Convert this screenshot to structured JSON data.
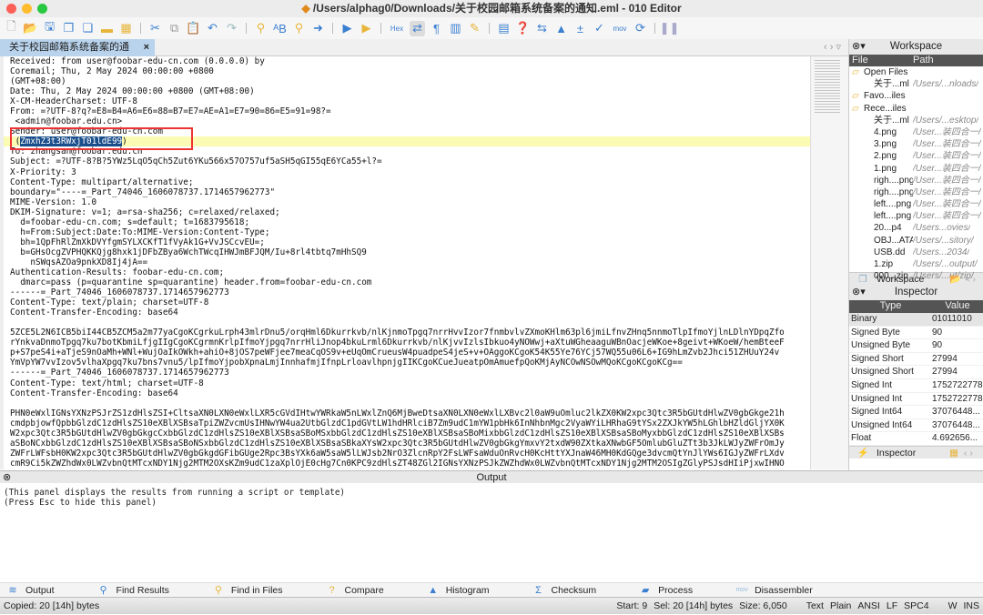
{
  "window": {
    "title": "/Users/alphag0/Downloads/关于校园邮箱系统备案的通知.eml - 010 Editor"
  },
  "toolbar": {
    "hex_label": "Hex",
    "mov_label": "mov",
    "icons": [
      "new-file-icon",
      "open-file-icon",
      "save-icon",
      "save-as-icon",
      "save-all-icon",
      "open-folder-icon",
      "workspace-icon",
      "cut-icon",
      "copy-icon",
      "paste-icon",
      "undo-icon",
      "redo-icon",
      "find-icon",
      "replace-icon",
      "find-in-files-icon",
      "goto-icon",
      "run-script-icon",
      "run-template-icon",
      "hex-mode-icon",
      "toggle-icon",
      "pilcrow-icon",
      "columns-icon",
      "highlight-icon",
      "calculator-icon",
      "clipboard-icon",
      "compare-icon",
      "histogram-icon",
      "checksum-icon",
      "edit-icon",
      "disassembler-icon",
      "base-convert-icon",
      "pause-icon"
    ]
  },
  "file_tab": {
    "label": "关于校园邮箱系统备案的通知.eml",
    "close": "×"
  },
  "editor": {
    "lines": [
      "Received: from user@foobar-edu-cn.com (0.0.0.0) by",
      "Coremail; Thu, 2 May 2024 00:00:00 +0800",
      "(GMT+08:00)",
      "Date: Thu, 2 May 2024 00:00:00 +0800 (GMT+08:00)",
      "X-CM-HeaderCharset: UTF-8",
      "From: =?UTF-8?q?=E8=B4=A6=E6=88=B7=E7=AE=A1=E7=90=86=E5=91=98?=",
      " <admin@foobar.edu.cn>",
      "Sender: user@foobar-edu-cn.com",
      "",
      "To: zhangsan@foobar.edu.cn",
      "Subject: =?UTF-8?B?5YWz5LqO5qCh5Zut6YKu566x57O757uf5aSH5qGI55qE6YCa55+l?=",
      "X-Priority: 3",
      "Content-Type: multipart/alternative;",
      "boundary=\"----=_Part_74046_1606078737.1714657962773\"",
      "MIME-Version: 1.0",
      "DKIM-Signature: v=1; a=rsa-sha256; c=relaxed/relaxed;",
      "  d=foobar-edu-cn.com; s=default; t=1683795618;",
      "  h=From:Subject:Date:To:MIME-Version:Content-Type;",
      "  bh=1QpFhRlZmXkDVYfgmSYLXCKfT1fVyAk1G+VvJSCcvEU=;",
      "  b=GHsOcgZVPHQKKQjg8hxk1jDFbZBya6WchTWcqIHWJmBFJQM/Iu+8rl4tbtq7mHhSQ9",
      "    nSWqsAZOa9pnkXD8Ij4jA==",
      "Authentication-Results: foobar-edu-cn.com;",
      "  dmarc=pass (p=quarantine sp=quarantine) header.from=foobar-edu-cn.com",
      "------=_Part_74046_1606078737.1714657962773",
      "Content-Type: text/plain; charset=UTF-8",
      "Content-Transfer-Encoding: base64",
      "",
      "5ZCE5L2N6ICB5biI44CB5ZCM5a2m77yaCgoKCgrkuLrph43mlrDnu5/orqHml6Dkurrkvb/nlKjnmoTpgq7nrrHvvIzor7fnmbvlvZXmoKHlm63pl6jmiLfnvZHnq5nnmoTlpIfmoYjlnLDlnYDpqZfo",
      "rYnkvaDnmoTpgq7ku7botKbmiLfjgIIgCgoKCgrmnKrlpIfmoYjpgq7nrrHliJnop4bkuLrml6Dkurrkvb/nlKjvvIzlsIbkuo4yNOWwj+aXtuWGheaaguWBnOacjeWKoe+8geivt+WKoeW/hemBteeF",
      "p+S7peS4i+aTjeS9nOaMh+WNl+WujOaIkOWkh+ahiO+8jOS7peWFjee7meaCqOS9v+eUqOmCrueusW4puadpeS4jeS+v+OAggoKCgoK54K55Ye76YCj57WQ55u06L6+IG9hLmZvb2Jhci51ZHUuY24v",
      "YmVpYW7vvIzov5vlhaXpgq7ku7bns7vnu5/lpIfmoYjpobXpnaLmjInnhafmjIfnpLrloavlhpnjgIIKCgoKCueJueatpOmAmuefpQoKMjAyNCOwNSOwMQoKCgoKCgoKCg==",
      "------=_Part_74046_1606078737.1714657962773",
      "Content-Type: text/html; charset=UTF-8",
      "Content-Transfer-Encoding: base64",
      "",
      "PHN0eWxlIGNsYXNzPSJrZS1zdHlsZSI+CltsaXN0LXN0eWxlLXR5cGVdIHtwYWRkaW5nLWxlZnQ6MjBweDtsaXN0LXN0eWxlLXBvc2l0aW9uOmluc2lkZX0KW2xpc3Qtc3R5bGUtdHlwZV0gbGkge21h",
      "cmdpbjowfQpbbGlzdC1zdHlsZS10eXBlXSBsaTpiZWZvcmUsIHNwYW4ua2UtbGlzdC1pdGVtLW1hdHRlciB7Zm9udC1mYW1pbHk6InNhbnMgc2VyaWYiLHRhaG9tYSx2ZXJkYW5hLGhlbHZldGljYX0K",
      "W2xpc3Qtc3R5bGUtdHlwZV0gbGkgcCxbbGlzdC1zdHlsZS10eXBlXSBsaSBoMSxbbGlzdC1zdHlsZS10eXBlXSBsaSBoMixbbGlzdC1zdHlsZS10eXBlXSBsaSBoMyxbbGlzdC1zdHlsZS10eXBlXSBs",
      "aSBoNCxbbGlzdC1zdHlsZS10eXBlXSBsaSBoNSxbbGlzdC1zdHlsZS10eXBlXSBsaSBkaXYsW2xpc3Qtc3R5bGUtdHlwZV0gbGkgYmxvY2txdW90ZXtkaXNwbGF5OmlubGluZTt3b3JkLWJyZWFrOmJy",
      "ZWFrLWFsbH0KW2xpc3Qtc3R5bGUtdHlwZV0gbGkgdGFibGUge2Rpc3BsYXk6aW5saW5lLWJsb2NrO3ZlcnRpY2FsLWFsaWduOnRvcH0KcHttYXJnaW46MH0KdGQge3dvcmQtYnJlYWs6IGJyZWFrLXdv",
      "cmR9Ci5kZWZhdWx0LWZvbnQtMTcxNDY1Njg2MTM2OXsKZm9udC1zaXplOjE0cHg7Cn0KPC9zdHlsZT48ZGl2IGNsYXNzPSJkZWZhdWx0LWZvbnQtMTcxNDY1Njg2MTM2OSIgZGlyPSJsdHIiPjxwIHNO"
    ],
    "selected_line": {
      "prefix": " (",
      "selected": "ZmxhZ3t3RWxjT01ldE99",
      "suffix": ")"
    },
    "highlight_color": "#fbfbb4",
    "selection_color": "#1b4f8c",
    "annotation_box_color": "#e33333"
  },
  "workspace": {
    "title": "Workspace",
    "col_file": "File",
    "col_path": "Path",
    "rows": [
      {
        "file": "Open Files",
        "path": "",
        "group": true
      },
      {
        "file": "关于...ml",
        "path": "/Users/...nloads/"
      },
      {
        "file": "Favo...iles",
        "path": "",
        "group": true
      },
      {
        "file": "Rece...iles",
        "path": "",
        "group": true
      },
      {
        "file": "关于...ml",
        "path": "/Users/...esktop/"
      },
      {
        "file": "4.png",
        "path": "/User...装四合一/"
      },
      {
        "file": "3.png",
        "path": "/User...装四合一/"
      },
      {
        "file": "2.png",
        "path": "/User...装四合一/"
      },
      {
        "file": "1.png",
        "path": "/User...装四合一/"
      },
      {
        "file": "righ....png",
        "path": "/User...装四合一/"
      },
      {
        "file": "righ....png",
        "path": "/User...装四合一/"
      },
      {
        "file": "left....png",
        "path": "/User...装四合一/"
      },
      {
        "file": "left....png",
        "path": "/User...装四合一/"
      },
      {
        "file": "20...p4",
        "path": "/Users...ovies/"
      },
      {
        "file": "OBJ...ATA",
        "path": "/Users/...sitory/"
      },
      {
        "file": "USB.dd",
        "path": "/Users...2034/"
      },
      {
        "file": "1.zip",
        "path": "/Users/...output/"
      },
      {
        "file": "000...zip",
        "path": "/Users/...ut/zip/"
      }
    ],
    "tab_label": "Workspace"
  },
  "inspector": {
    "title": "Inspector",
    "col_type": "Type",
    "col_value": "Value",
    "rows": [
      {
        "type": "Binary",
        "value": "01011010"
      },
      {
        "type": "Signed Byte",
        "value": "90"
      },
      {
        "type": "Unsigned Byte",
        "value": "90"
      },
      {
        "type": "Signed Short",
        "value": "27994"
      },
      {
        "type": "Unsigned Short",
        "value": "27994"
      },
      {
        "type": "Signed Int",
        "value": "1752722778"
      },
      {
        "type": "Unsigned Int",
        "value": "1752722778"
      },
      {
        "type": "Signed Int64",
        "value": "37076448..."
      },
      {
        "type": "Unsigned Int64",
        "value": "37076448..."
      },
      {
        "type": "Float",
        "value": "4.692656..."
      }
    ],
    "tab_label": "Inspector"
  },
  "output": {
    "title": "Output",
    "lines": [
      "(This panel displays the results from running a script or template)",
      "(Press Esc to hide this panel)"
    ]
  },
  "bottom_tabs": [
    "Output",
    "Find Results",
    "Find in Files",
    "Compare",
    "Histogram",
    "Checksum",
    "Process",
    "Disassembler"
  ],
  "status": {
    "left": "Copied: 20 [14h] bytes",
    "start": "Start: 9",
    "sel": "Sel: 20 [14h] bytes",
    "size": "Size: 6,050",
    "mode": "Text",
    "format": "Plain",
    "encoding": "ANSI",
    "line_end": "LF",
    "tab": "SPC4",
    "w": "W",
    "ins": "INS"
  }
}
